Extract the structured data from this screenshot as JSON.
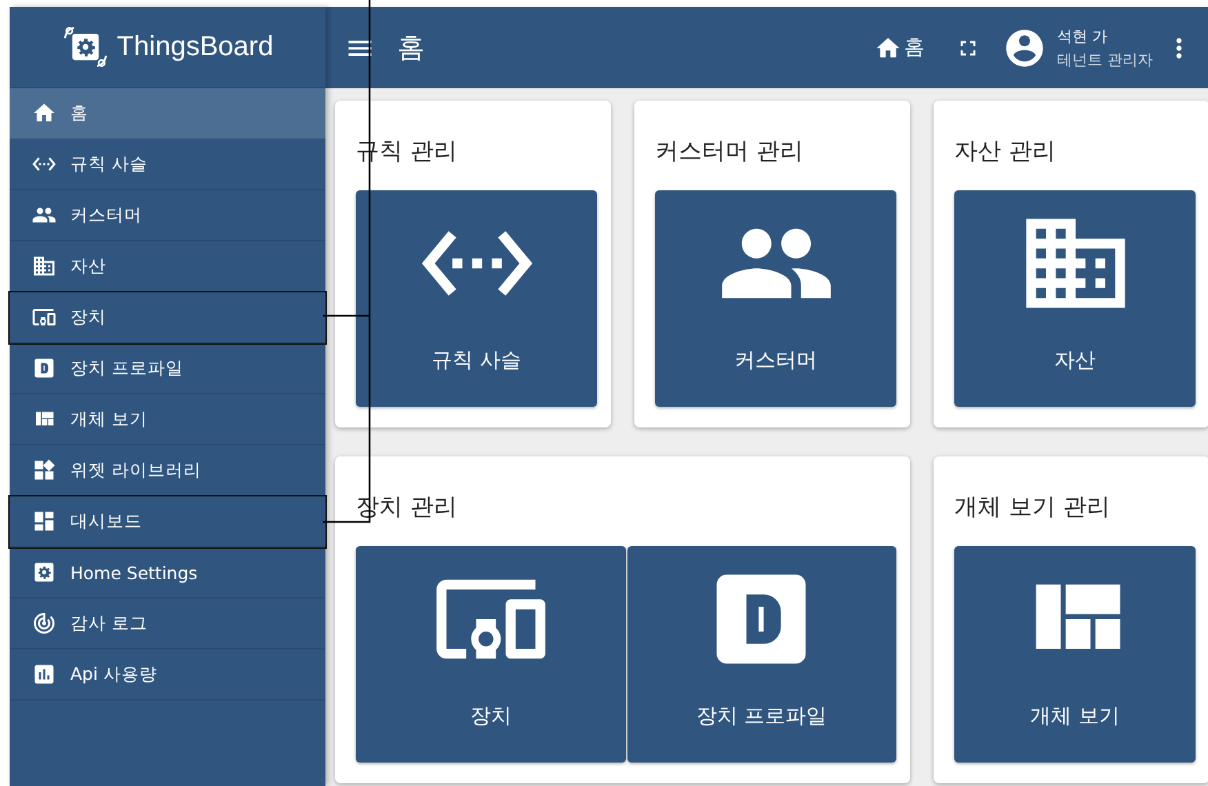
{
  "header": {
    "logo": "ThingsBoard",
    "page_title": "홈",
    "breadcrumb": "홈",
    "user_name": "석현 가",
    "user_role": "테넌트 관리자"
  },
  "sidebar": {
    "items": [
      {
        "label": "홈",
        "selected": true,
        "callout": false
      },
      {
        "label": "규칙 사슬",
        "selected": false,
        "callout": false
      },
      {
        "label": "커스터머",
        "selected": false,
        "callout": false
      },
      {
        "label": "자산",
        "selected": false,
        "callout": false
      },
      {
        "label": "장치",
        "selected": false,
        "callout": true
      },
      {
        "label": "장치 프로파일",
        "selected": false,
        "callout": false
      },
      {
        "label": "개체 보기",
        "selected": false,
        "callout": false
      },
      {
        "label": "위젯 라이브러리",
        "selected": false,
        "callout": false
      },
      {
        "label": "대시보드",
        "selected": false,
        "callout": true
      },
      {
        "label": "Home Settings",
        "selected": false,
        "callout": false
      },
      {
        "label": "감사 로그",
        "selected": false,
        "callout": false
      },
      {
        "label": "Api 사용량",
        "selected": false,
        "callout": false
      }
    ]
  },
  "sections": [
    {
      "title": "규칙 관리",
      "tiles": [
        {
          "label": "규칙 사슬"
        }
      ]
    },
    {
      "title": "커스터머 관리",
      "tiles": [
        {
          "label": "커스터머"
        }
      ]
    },
    {
      "title": "자산 관리",
      "tiles": [
        {
          "label": "자산"
        }
      ]
    },
    {
      "title": "장치 관리",
      "tiles": [
        {
          "label": "장치"
        },
        {
          "label": "장치 프로파일"
        }
      ]
    },
    {
      "title": "개체 보기 관리",
      "tiles": [
        {
          "label": "개체 보기"
        }
      ]
    }
  ]
}
